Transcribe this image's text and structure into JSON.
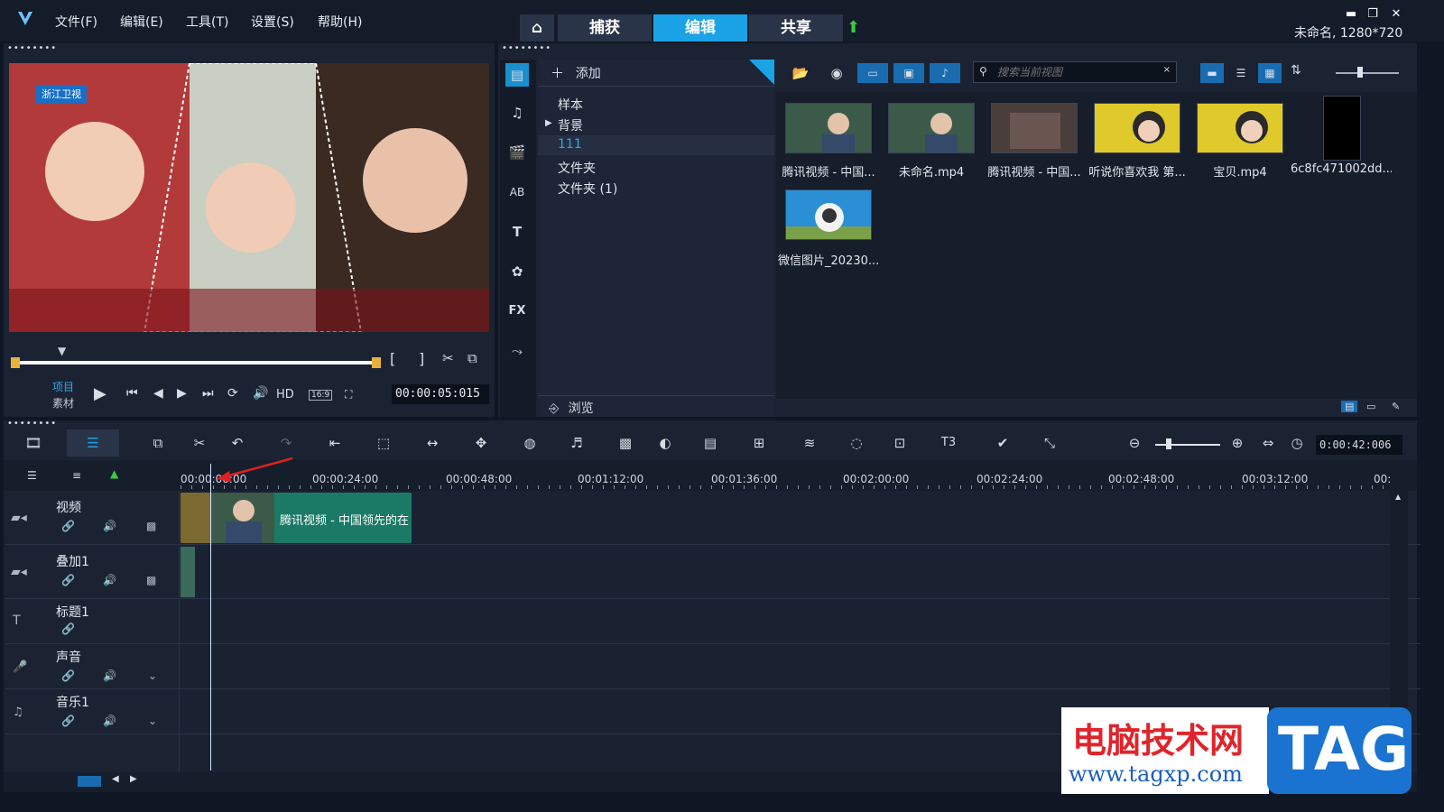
{
  "menu": [
    "文件(F)",
    "编辑(E)",
    "工具(T)",
    "设置(S)",
    "帮助(H)"
  ],
  "nav_tabs": [
    "捕获",
    "编辑",
    "共享"
  ],
  "project_info": "未命名, 1280*720",
  "library": {
    "add_label": "添加",
    "tree": [
      "样本",
      "背景",
      "111",
      "文件夹",
      "文件夹 (1)"
    ],
    "browse_label": "浏览",
    "search_placeholder": "搜索当前视图",
    "thumbnails": [
      {
        "caption": "腾讯视频 - 中国..."
      },
      {
        "caption": "未命名.mp4"
      },
      {
        "caption": "腾讯视频 - 中国..."
      },
      {
        "caption": "听说你喜欢我 第..."
      },
      {
        "caption": "宝贝.mp4"
      },
      {
        "caption": "6c8fc471002dd..."
      },
      {
        "caption": "微信图片_20230..."
      }
    ]
  },
  "preview": {
    "mode_project": "项目",
    "mode_clip": "素材",
    "hd_label": "HD",
    "aspect": "16:9",
    "timecode": "00:00:05:015",
    "bracket_in": "[",
    "bracket_out": "]",
    "watermark_channel": "浙江卫视"
  },
  "timeline": {
    "duration": "0:00:42:006",
    "ruler": [
      "00:00:00:00",
      "00:00:24:00",
      "00:00:48:00",
      "00:01:12:00",
      "00:01:36:00",
      "00:02:00:00",
      "00:02:24:00",
      "00:02:48:00",
      "00:03:12:00",
      "00:"
    ],
    "tracks": [
      "视频",
      "叠加1",
      "标题1",
      "声音",
      "音乐1"
    ],
    "clip_label": "腾讯视频 - 中国领先的在"
  },
  "watermark": {
    "title": "电脑技术网",
    "url": "www.tagxp.com",
    "badge": "TAG"
  },
  "colors": {
    "accent": "#1aa3e6",
    "clip": "#1a7a66",
    "panel": "#1b2333",
    "background": "#0f1724"
  }
}
